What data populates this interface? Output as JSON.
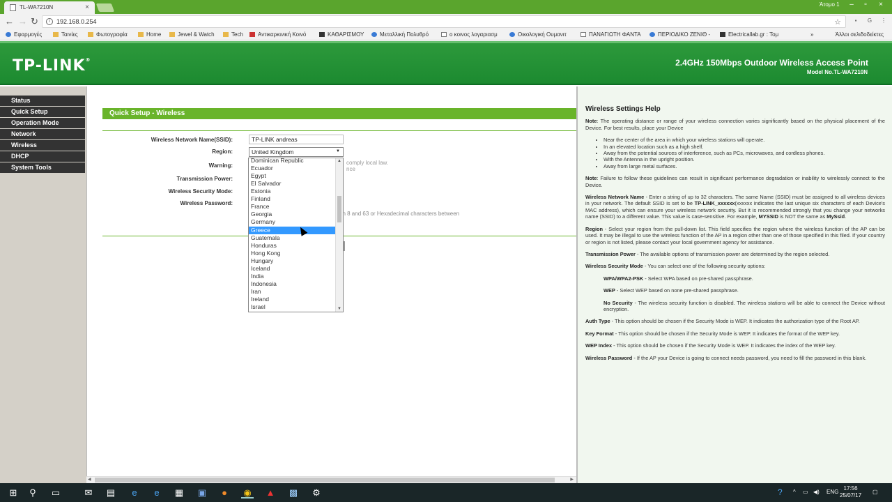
{
  "browser": {
    "tab_title": "TL-WA7210N",
    "user": "Άτομο 1",
    "url": "192.168.0.254",
    "bookmarks": [
      "Εφαρμογές",
      "Ταινίες",
      "Φωτογραφία",
      "Home",
      "Jewel & Watch",
      "Tech",
      "Αντικαρκινική Κοινό",
      "ΚΑΘΑΡΙΣΜΟΥ",
      "Μεταλλική Πολυθρό",
      "ο κοινος λογαριασμ",
      "Οικολογική Ουμανιτ",
      "ΠΑΝΑΓΙΩΤΗ ΦΑΝΤΑ",
      "ΠΕΡΙΟΔΙΚΟ ΖΕΝΙΘ -",
      "Electricallab.gr : Τομ"
    ],
    "bookmarks_more": "»",
    "other_bookmarks": "Άλλοι σελιδοδείκτες"
  },
  "header": {
    "logo": "TP-LINK",
    "logo_mark": "®",
    "product": "2.4GHz 150Mbps Outdoor Wireless Access Point",
    "model": "Model No.TL-WA7210N"
  },
  "menu": [
    "Status",
    "Quick Setup",
    "Operation Mode",
    "Network",
    "Wireless",
    "DHCP",
    "System Tools"
  ],
  "form": {
    "title": "Quick Setup - Wireless",
    "ssid_label": "Wireless Network Name(SSID):",
    "ssid_value": "TP-LINK andreas",
    "region_label": "Region:",
    "region_value": "United Kingdom",
    "warning_label": "Warning:",
    "warning_hint_1": "comply local law.",
    "warning_hint_2": "nce",
    "power_label": "Transmission Power:",
    "security_label": "Wireless Security Mode:",
    "password_label": "Wireless Password:",
    "password_hint": "en 8 and 63 or Hexadecimal characters between"
  },
  "dropdown": {
    "options": [
      "Dominican Republic",
      "Ecuador",
      "Egypt",
      "El Salvador",
      "Estonia",
      "Finland",
      "France",
      "Georgia",
      "Germany",
      "Greece",
      "Guatemala",
      "Honduras",
      "Hong Kong",
      "Hungary",
      "Iceland",
      "India",
      "Indonesia",
      "Iran",
      "Ireland",
      "Israel"
    ],
    "highlighted": "Greece"
  },
  "help": {
    "title": "Wireless Settings Help",
    "note1_label": "Note",
    "note1": ": The operating distance or range of your wireless connection varies significantly based on the physical placement of the Device. For best results, place your Device",
    "bullets": [
      "Near the center of the area in which your wireless stations will operate.",
      "In an elevated location such as a high shelf.",
      "Away from the potential sources of interference, such as PCs, microwaves, and cordless phones.",
      "With the Antenna in the upright position.",
      "Away from large metal surfaces."
    ],
    "note2_label": "Note",
    "note2": ": Failure to follow these guidelines can result in significant performance degradation or inability to wirelessly connect to the Device.",
    "ssid_label": "Wireless Network Name",
    "ssid_text_1": " - Enter a string of up to 32 characters. The same Name (SSID) must be assigned to all wireless devices in your network. The default SSID is set to be ",
    "ssid_default": "TP-LINK_xxxxxx",
    "ssid_text_2": "(xxxxxx indicates the last unique six characters of each Device's MAC address), which can ensure your wireless network security. But it is recommended strongly that you change your networks name (SSID) to a different value. This value is case-sensitive. For example, ",
    "ssid_ex1": "MYSSID",
    "ssid_text_3": " is NOT the same as ",
    "ssid_ex2": "MySsid",
    "ssid_text_4": ".",
    "region_label": "Region",
    "region_text": " - Select your region from the pull-down list. This field specifies the region where the wireless function of the AP can be used. It may be illegal to use the wireless function of the AP in a region other than one of those specified in this filed. If your country or region is not listed, please contact your local government agency for assistance.",
    "power_label": "Transmission Power",
    "power_text": " - The available options of transmission power are determined by the region selected.",
    "secmode_label": "Wireless Security Mode",
    "secmode_text": " - You can select one of the following security options:",
    "wpa_label": "WPA/WPA2-PSK",
    "wpa_text": " - Select WPA based on pre-shared passphrase.",
    "wep_label": "WEP",
    "wep_text": " - Select WEP based on none pre-shared passphrase.",
    "nosec_label": "No Security",
    "nosec_text": " - The wireless security function is disabled. The wireless stations will be able to connect the Device without encryption.",
    "auth_label": "Auth Type",
    "auth_text": " - This option should be chosen if the Security Mode is WEP. It indicates the authorization type of the Root AP.",
    "keyfmt_label": "Key Format",
    "keyfmt_text": " - This option should be chosen if the Security Mode is WEP. It indicates the format of the WEP key.",
    "wepidx_label": "WEP Index",
    "wepidx_text": " - This option should be chosen if the Security Mode is WEP. It indicates the index of the WEP key.",
    "pass_label": "Wireless Password",
    "pass_text": " - If the AP your Device is going to connect needs password, you need to fill the password in this blank."
  },
  "taskbar": {
    "lang": "ENG",
    "time": "17:56",
    "date": "25/07/17"
  },
  "colors": {
    "brand_green": "#1c8a30",
    "section_green": "#69b42a",
    "menu_dark": "#333333",
    "highlight_blue": "#3399ff",
    "help_bg": "#f1f7ef"
  }
}
